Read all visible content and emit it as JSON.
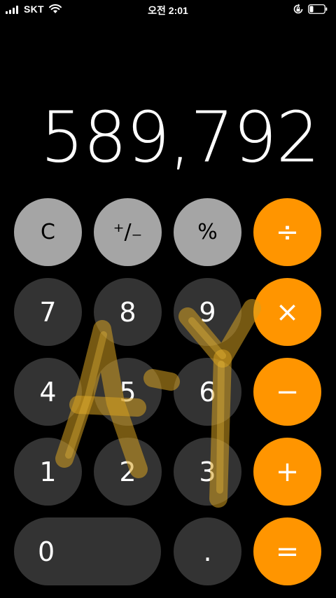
{
  "status_bar": {
    "carrier": "SKT",
    "time": "오전 2:01",
    "battery_level": 0.25,
    "icons": [
      "signal-icon",
      "wifi-icon",
      "rotation-lock-icon",
      "battery-icon"
    ]
  },
  "display": {
    "value": "589,792"
  },
  "keys": {
    "clear": "C",
    "sign": "⁺/₋",
    "percent": "%",
    "divide": "÷",
    "multiply": "×",
    "subtract": "−",
    "add": "+",
    "equals": "=",
    "decimal": ".",
    "d0": "0",
    "d1": "1",
    "d2": "2",
    "d3": "3",
    "d4": "4",
    "d5": "5",
    "d6": "6",
    "d7": "7",
    "d8": "8",
    "d9": "9"
  },
  "colors": {
    "background": "#000000",
    "function_key": "#a5a5a5",
    "number_key": "#333333",
    "operator_key": "#ff9500",
    "overlay_scribble": "#d6a020"
  }
}
